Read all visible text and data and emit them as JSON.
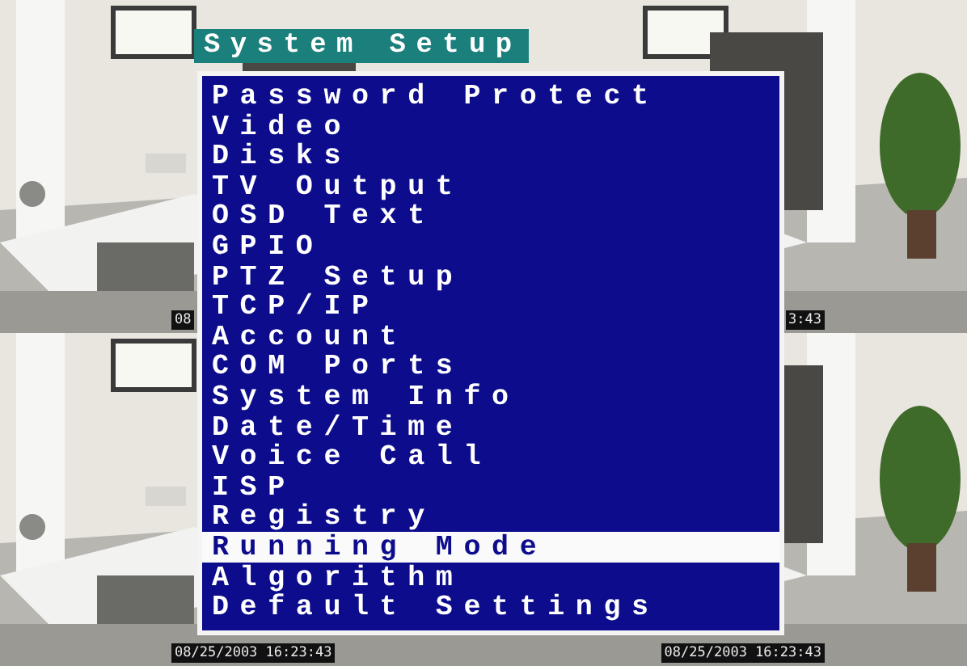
{
  "cameras": [
    {
      "kind": "picture",
      "timestamp": "08"
    },
    {
      "kind": "picture",
      "timestamp": "3:43"
    },
    {
      "kind": "picture",
      "timestamp": "08/25/2003 16:23:43"
    },
    {
      "kind": "picture",
      "timestamp": "08/25/2003 16:23:43"
    }
  ],
  "menu": {
    "title": "System Setup",
    "items": [
      {
        "label": "Password Protect",
        "selected": false
      },
      {
        "label": "Video",
        "selected": false
      },
      {
        "label": "Disks",
        "selected": false
      },
      {
        "label": "TV Output",
        "selected": false
      },
      {
        "label": "OSD Text",
        "selected": false
      },
      {
        "label": "GPIO",
        "selected": false
      },
      {
        "label": "PTZ Setup",
        "selected": false
      },
      {
        "label": "TCP/IP",
        "selected": false
      },
      {
        "label": "Account",
        "selected": false
      },
      {
        "label": "COM Ports",
        "selected": false
      },
      {
        "label": "System Info",
        "selected": false
      },
      {
        "label": "Date/Time",
        "selected": false
      },
      {
        "label": "Voice Call",
        "selected": false
      },
      {
        "label": "ISP",
        "selected": false
      },
      {
        "label": "Registry",
        "selected": false
      },
      {
        "label": "Running Mode",
        "selected": true
      },
      {
        "label": "Algorithm",
        "selected": false
      },
      {
        "label": "Default Settings",
        "selected": false
      }
    ]
  }
}
